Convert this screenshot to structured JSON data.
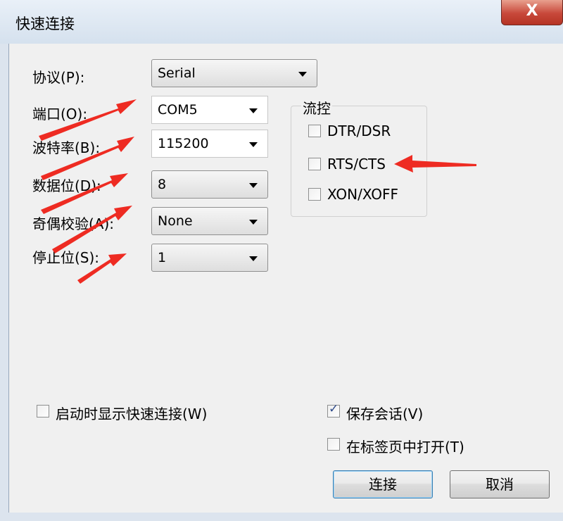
{
  "window": {
    "title": "快速连接",
    "close_glyph": "X"
  },
  "form": {
    "protocol": {
      "label": "协议(P):",
      "value": "Serial"
    },
    "port": {
      "label": "端口(O):",
      "value": "COM5"
    },
    "baud": {
      "label": "波特率(B):",
      "value": "115200"
    },
    "data_bits": {
      "label": "数据位(D):",
      "value": "8"
    },
    "parity": {
      "label": "奇偶校验(A):",
      "value": "None"
    },
    "stop_bits": {
      "label": "停止位(S):",
      "value": "1"
    }
  },
  "flow_control": {
    "title": "流控",
    "options": [
      {
        "label": "DTR/DSR",
        "checked": false
      },
      {
        "label": "RTS/CTS",
        "checked": false
      },
      {
        "label": "XON/XOFF",
        "checked": false
      }
    ]
  },
  "options": {
    "show_on_start": {
      "label": "启动时显示快速连接(W)",
      "checked": false
    },
    "save_session": {
      "label": "保存会话(V)",
      "checked": true
    },
    "open_in_tab": {
      "label": "在标签页中打开(T)",
      "checked": false
    }
  },
  "buttons": {
    "connect": "连接",
    "cancel": "取消"
  },
  "colors": {
    "annotation_arrow": "#ee2b22",
    "title_bar": "#dce4ee",
    "close_button": "#c8483a"
  },
  "icons": {
    "close": "close-icon",
    "dropdown": "chevron-down-icon",
    "check": "checkmark-icon"
  }
}
